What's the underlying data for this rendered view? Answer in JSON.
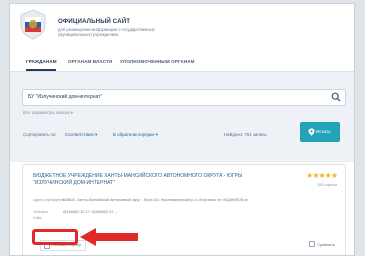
{
  "header": {
    "title": "ОФИЦИАЛЬНЫЙ САЙТ",
    "subtitle_line1": "для размещения информации о государственных",
    "subtitle_line2": "(муниципальных) учреждениях"
  },
  "nav": {
    "items": [
      {
        "label": "ГРАЖДАНАМ",
        "active": true
      },
      {
        "label": "ОРГАНАМ ВЛАСТИ",
        "active": false
      },
      {
        "label": "УПОЛНОМОЧЕННЫМ ОРГАНАМ",
        "active": false
      }
    ]
  },
  "search": {
    "value": "БУ \"Излучинский дом-интернат\"",
    "advanced_link": "Все параметры поиска ▾"
  },
  "sorting": {
    "label": "Сортировать по:",
    "value": "Соответствию ▾",
    "order": "В обратном порядке ▾",
    "found": "Найдено: 761 запись"
  },
  "find_button": {
    "label": "Искать"
  },
  "result": {
    "title_line1": "БЮДЖЕТНОЕ УЧРЕЖДЕНИЕ ХАНТЫ-МАНСИЙСКОГО АВТОНОМНОГО ОКРУГА - ЮГРЫ",
    "title_line2": "\"ИЗЛУЧИНСКИЙ ДОМ-ИНТЕРНАТ\"",
    "stars": "★★★★★",
    "rating_count": "383 оценки",
    "address_label": "Адрес учреждения:",
    "address_value": "628634, Ханты-Мансийский Автономный округ - Югра АО, Нижневартовский р-н, Излучинск пгт, ВОДНИКОВ ул.",
    "phone_label": "Телефон:",
    "phone_value": "8(34668)2-87-17; 8(34668)2-87-...",
    "site_label": "Сайт:",
    "rate_label": "Поставить оценку",
    "compare_label": "Сравнить"
  },
  "colors": {
    "accent": "#23a3b7",
    "highlight": "#e02a2a",
    "link": "#2f5d8f",
    "star": "#f0b52b"
  }
}
